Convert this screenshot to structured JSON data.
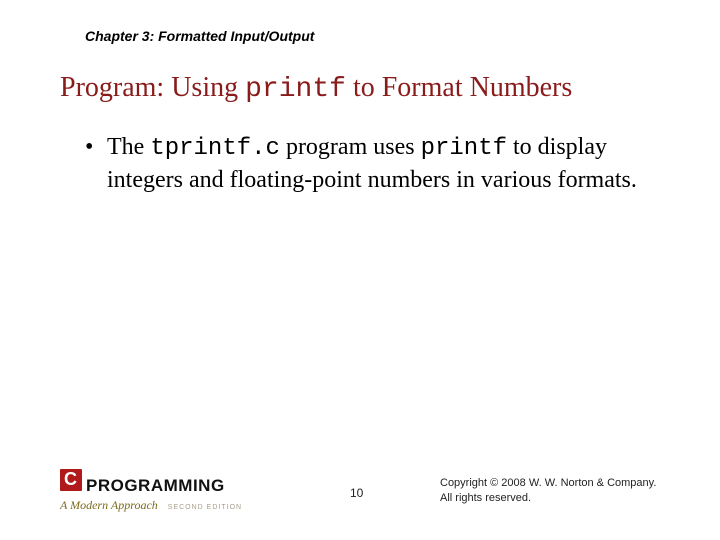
{
  "chapter": "Chapter 3: Formatted Input/Output",
  "title": {
    "pre": "Program: Using ",
    "code": "printf",
    "post": " to Format Numbers"
  },
  "bullet1": {
    "dot": "•",
    "seg1": "The ",
    "code1": "tprintf.c",
    "seg2": " program uses ",
    "code2": "printf",
    "seg3": " to display integers and floating-point numbers in various formats."
  },
  "logo": {
    "word": "PROGRAMMING",
    "subtitle": "A Modern Approach",
    "edition": "SECOND EDITION"
  },
  "page_number": "10",
  "copyright_line1": "Copyright © 2008 W. W. Norton & Company.",
  "copyright_line2": "All rights reserved."
}
